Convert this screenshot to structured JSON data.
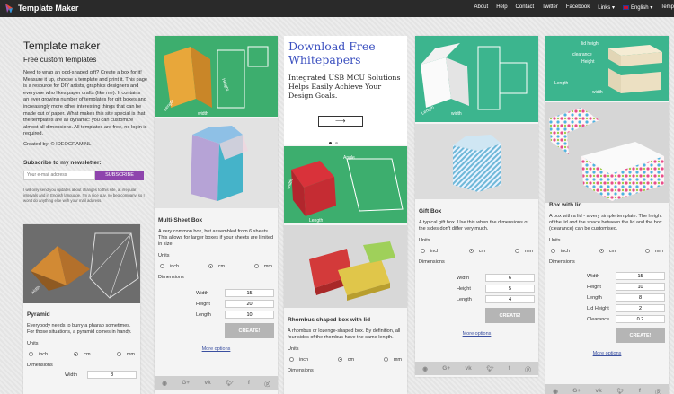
{
  "topbar": {
    "brand": "Template Maker",
    "nav": [
      "About",
      "Help",
      "Contact",
      "Twitter",
      "Facebook",
      "Links",
      "English",
      "Temp"
    ]
  },
  "intro": {
    "title": "Template maker",
    "subtitle": "Free custom templates",
    "description": "Need to wrap an odd-shaped gift? Create a box for it! Measure it up, choose a template and print it. This page is a resource for DIY artists, graphics designers and everyone who likes paper crafts (like me). It contains an ever growing number of templates for gift boxes and increasingly more other interesting things that can be made out of paper. What makes this site special is that the templates are all dynamic: you can customize almost all dimensions. All templates are free, no login is required.",
    "created_by": "Created by: © IDEOGRAM.NL",
    "newsletter_heading": "Subscribe to my newsletter:",
    "email_placeholder": "Your e-mail address",
    "subscribe_label": "SUBSCRIBE",
    "note": "I will only send you updates about changes to this site, at irregular intervals and in English language. I'm a nice guy, no beg company, so I won't do anything else with your mail address."
  },
  "units": {
    "label": "Units",
    "inch": "inch",
    "cm": "cm",
    "mm": "mm"
  },
  "dimensions_label": "Dimensions",
  "create_label": "CREATE!",
  "more_options_label": "More options",
  "ad": {
    "headline": "Download Free Whitepapers",
    "body": "Integrated USB MCU Solutions Helps Easily Achieve Your Design Goals."
  },
  "cards": {
    "pyramid": {
      "title": "Pyramid",
      "text": "Everybody needs to burry a pharao sometimes. For those situations, a pyramid comes in handy.",
      "fields": [
        {
          "label": "Width",
          "value": "8"
        }
      ]
    },
    "multisheet": {
      "title": "Multi-Sheet Box",
      "text": "A very common box, but assembled from 6 sheets. This allows for larger boxes if your sheets are limited in size.",
      "fields": [
        {
          "label": "Width",
          "value": "15"
        },
        {
          "label": "Height",
          "value": "20"
        },
        {
          "label": "Length",
          "value": "10"
        }
      ]
    },
    "rhombus": {
      "title": "Rhombus shaped box with lid",
      "text": "A rhombus or lozenge-shaped box. By definition, all four sides of the rhombus have the same length."
    },
    "giftbox": {
      "title": "Gift Box",
      "text": "A typical gift box. Use this when the dimensions of the sides don't differ very much.",
      "fields": [
        {
          "label": "Width",
          "value": "6"
        },
        {
          "label": "Height",
          "value": "5"
        },
        {
          "label": "Length",
          "value": "4"
        }
      ]
    },
    "lidbox": {
      "title": "Box with lid",
      "text": "A box with a lid - a very simple template. The height of the lid and the space between the lid and the box (clearance) can be customised.",
      "fields": [
        {
          "label": "Width",
          "value": "15"
        },
        {
          "label": "Height",
          "value": "10"
        },
        {
          "label": "Length",
          "value": "8"
        },
        {
          "label": "Lid Height",
          "value": "2"
        },
        {
          "label": "Clearance",
          "value": "0.2"
        }
      ]
    }
  },
  "image_labels": {
    "length": "Length",
    "width": "width",
    "height": "Height",
    "angle": "Angle",
    "lid_height": "lid height",
    "clearance": "clearance"
  },
  "share_icons": [
    "reddit-icon",
    "google-plus-icon",
    "vk-icon",
    "twitter-icon",
    "facebook-icon",
    "pinterest-icon"
  ],
  "colors": {
    "topbar": "#2a2a2a",
    "subscribe": "#8e44ad",
    "green": "#3dae6e",
    "teal": "#3cb58e",
    "button": "#b5b5b5",
    "link": "#3a4fa0"
  }
}
